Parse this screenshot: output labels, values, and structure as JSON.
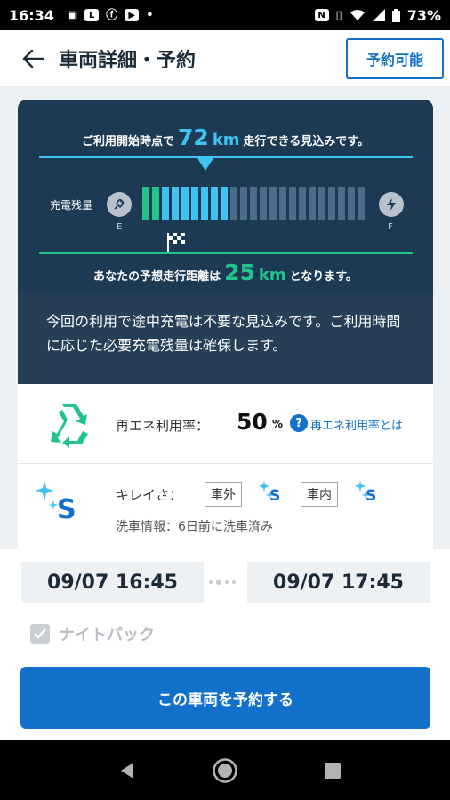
{
  "status_bar": {
    "time": "16:34",
    "battery_percent": "73%",
    "left_icons": [
      "image-icon",
      "line-icon",
      "facebook-icon",
      "youtube-icon",
      "dot-icon"
    ],
    "right_icons": [
      "nfc-icon",
      "vibrate-icon",
      "wifi-icon",
      "signal-icon",
      "battery-icon"
    ]
  },
  "header": {
    "title": "車両詳細・予約",
    "status_button": "予約可能",
    "accent": "#1170c9"
  },
  "range": {
    "prefix": "ご利用開始時点で",
    "value": "72",
    "unit": "km",
    "suffix": "走行できる見込みです。",
    "battery_label": "充電残量",
    "e_label": "E",
    "f_label": "F",
    "battery_segments_total": 23,
    "battery_segments_green": 2,
    "battery_segments_blue": 7,
    "pred_prefix": "あなたの予想走行距離は",
    "pred_value": "25",
    "pred_unit": "km",
    "pred_suffix": "となります。",
    "message": "今回の利用で途中充電は不要な見込みです。ご利用時間に応じた必要充電残量は確保します。"
  },
  "eco": {
    "label": "再エネ利用率：",
    "value": "50",
    "unit": "%",
    "help_link": "再エネ利用率とは"
  },
  "cleanliness": {
    "overall_grade": "S",
    "label": "キレイさ：",
    "exterior_label": "車外",
    "exterior_grade": "S",
    "interior_label": "車内",
    "interior_grade": "S",
    "wash_info": "洗車情報：6日前に洗車済み"
  },
  "booking": {
    "start": "09/07 16:45",
    "end": "09/07 17:45",
    "nightpack_label": "ナイトパック",
    "nightpack_checked": true,
    "reserve_button": "この車両を予約する"
  }
}
